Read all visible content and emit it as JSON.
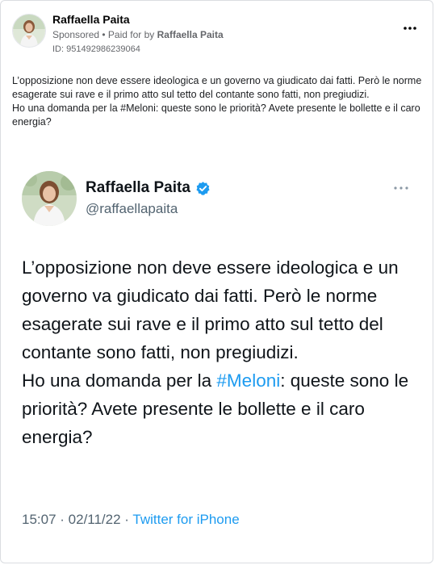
{
  "ad": {
    "page_name": "Raffaella Paita",
    "sponsored_label": "Sponsored",
    "separator": " • ",
    "paid_for_label": "Paid for by ",
    "payer": "Raffaella Paita",
    "id_label": "ID: 951492986239064",
    "more_icon": "more-horizontal-icon"
  },
  "caption": {
    "paragraph1": "L’opposizione non deve essere ideologica e un governo va giudicato dai fatti. Però le norme esagerate sui rave e il primo atto sul tetto del contante sono fatti, non pregiudizi.",
    "paragraph2": "Ho una domanda per la #Meloni: queste sono le priorità? Avete presente le bollette e il caro energia?"
  },
  "tweet": {
    "name": "Raffaella Paita",
    "handle": "@raffaellapaita",
    "verified_icon": "verified-badge-icon",
    "more_icon": "more-horizontal-icon",
    "body_line1": "L’opposizione non deve essere ideologica e un governo va giudicato dai fatti. Però le norme esagerate sui rave e il primo atto sul tetto del contante sono fatti, non pregiudizi.",
    "body_line2_prefix": "Ho una domanda per la ",
    "hashtag": "#Meloni",
    "body_line2_suffix": ": queste sono le priorità? Avete presente le bollette e il caro energia?",
    "time": "15:07",
    "date": "02/11/22",
    "meta_sep": " · ",
    "source": "Twitter for iPhone"
  },
  "colors": {
    "twitter_blue": "#1d9bf0",
    "muted_text": "#65676b"
  }
}
